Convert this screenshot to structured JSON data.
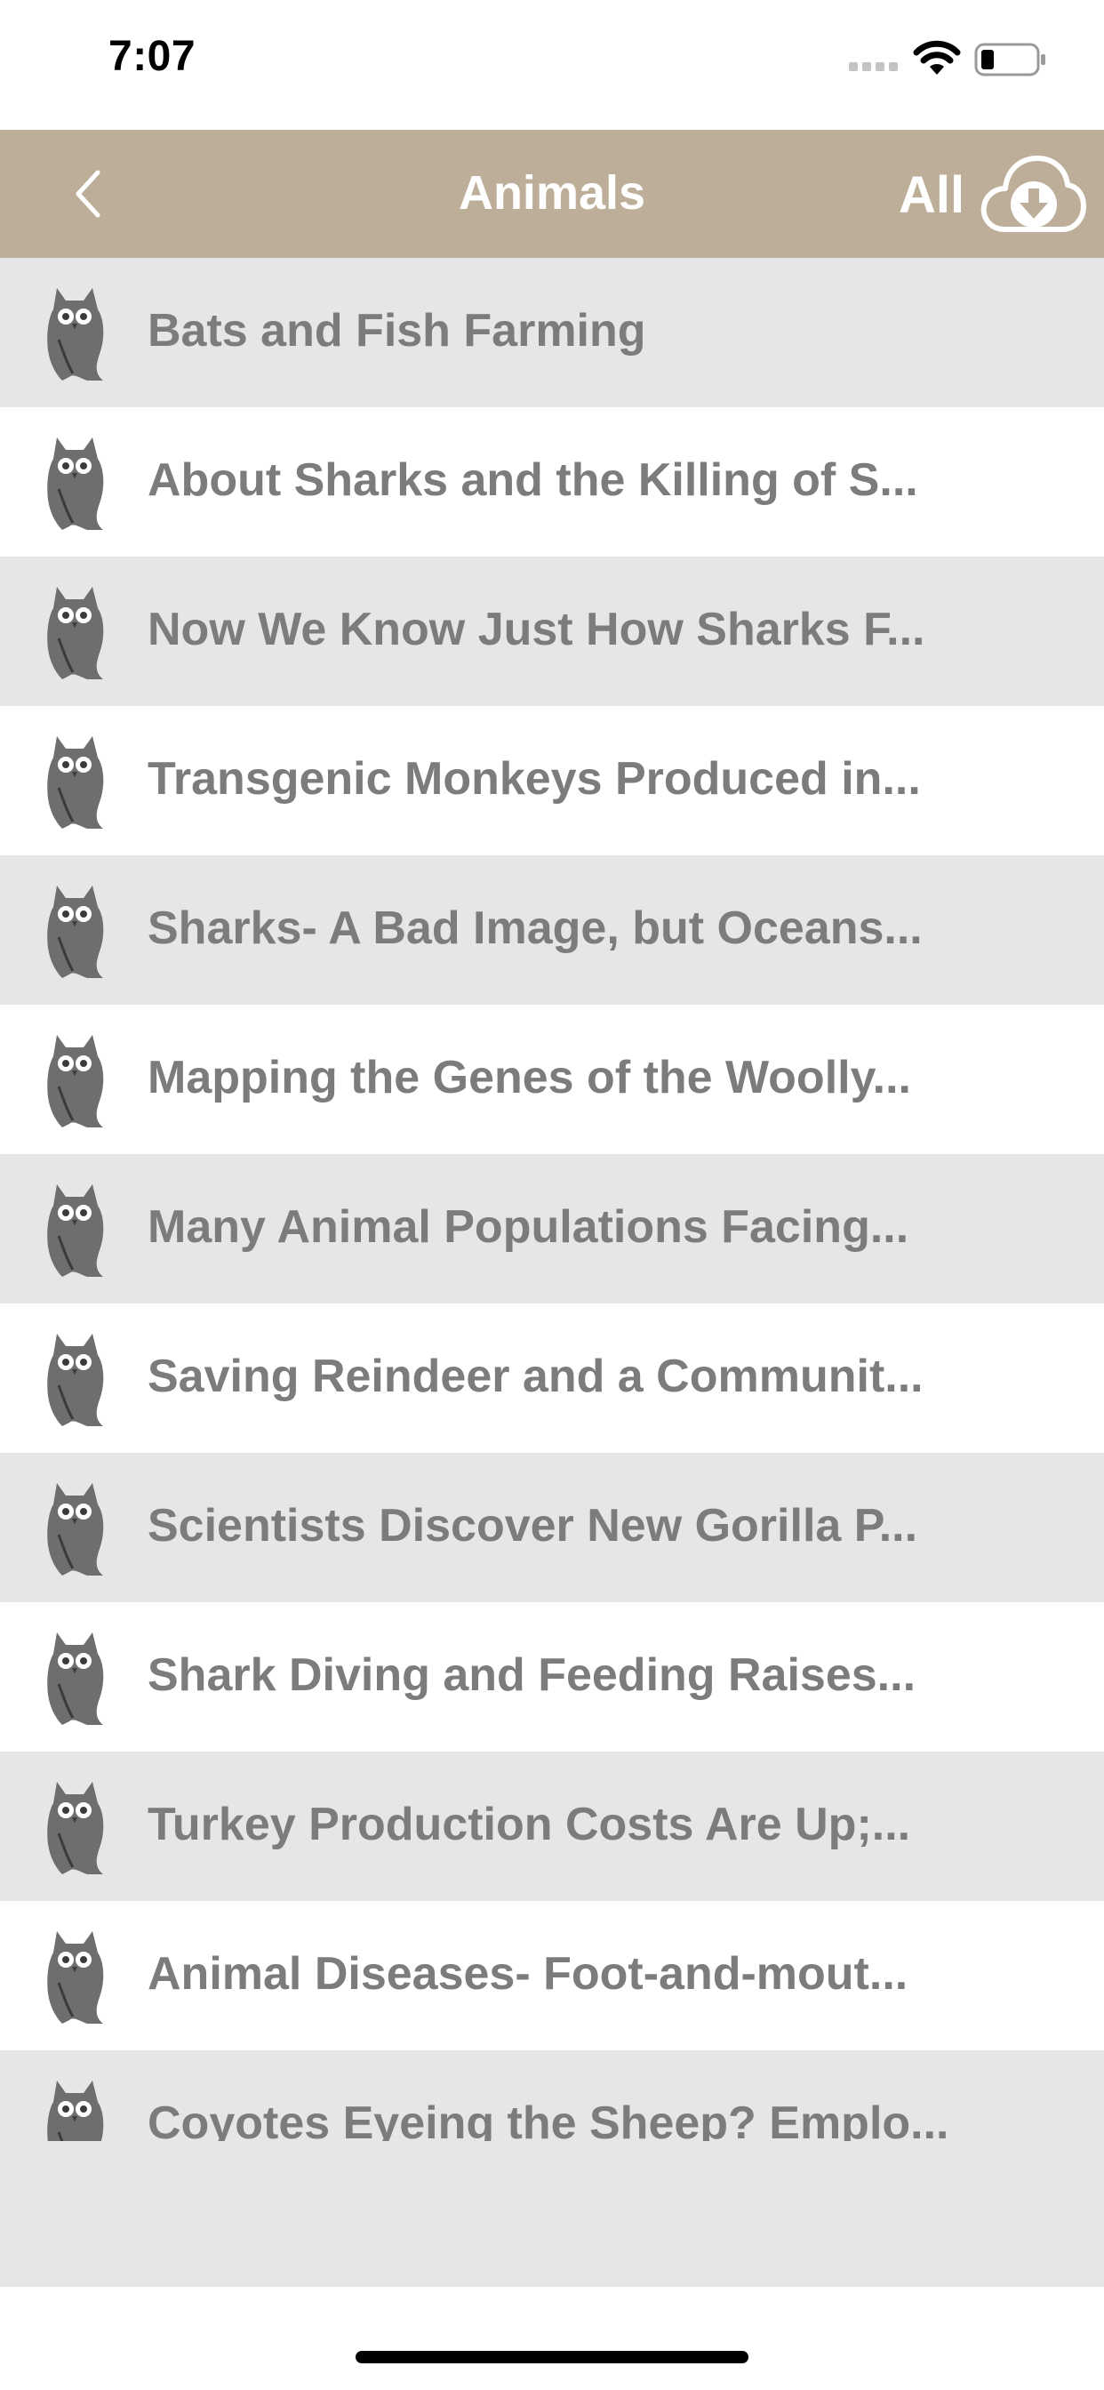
{
  "status_bar": {
    "time": "7:07"
  },
  "nav": {
    "title": "Animals",
    "download_all_label": "All"
  },
  "icons": {
    "back": "chevron-left-icon",
    "download": "cloud-download-icon",
    "item": "owl-icon"
  },
  "colors": {
    "nav_background": "#bcae98",
    "row_alt_background": "#e6e6e8",
    "row_text": "#7c7c7c"
  },
  "articles": [
    {
      "title": "Bats and Fish Farming"
    },
    {
      "title": "About Sharks and the Killing of S..."
    },
    {
      "title": "Now We Know Just How Sharks F..."
    },
    {
      "title": "Transgenic Monkeys Produced in..."
    },
    {
      "title": "Sharks- A Bad Image, but Oceans..."
    },
    {
      "title": "Mapping the Genes of the Woolly..."
    },
    {
      "title": "Many Animal Populations Facing..."
    },
    {
      "title": "Saving Reindeer and a Communit..."
    },
    {
      "title": "Scientists Discover New Gorilla P..."
    },
    {
      "title": "Shark Diving and Feeding Raises..."
    },
    {
      "title": "Turkey Production Costs Are Up;..."
    },
    {
      "title": "Animal Diseases- Foot-and-mout..."
    },
    {
      "title": "Coyotes Eyeing the Sheep? Emplo..."
    }
  ]
}
